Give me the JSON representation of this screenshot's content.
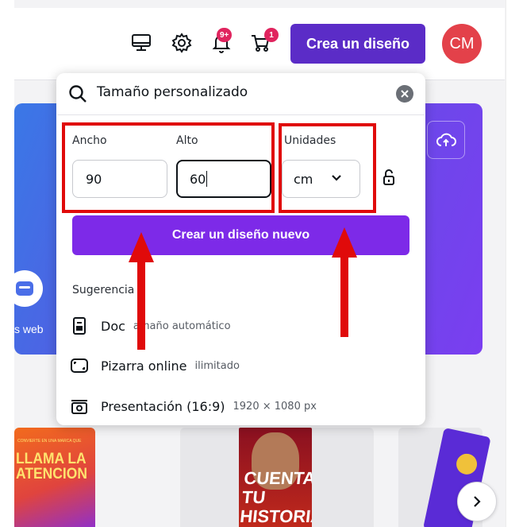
{
  "topbar": {
    "notifications_badge": "9+",
    "cart_badge": "1",
    "create_button_label": "Crea un diseño",
    "avatar_initials": "CM",
    "icons": [
      "desktop-icon",
      "gear-icon",
      "bell-icon",
      "cart-icon"
    ]
  },
  "hero": {
    "partial_text": "s web",
    "accent_color": "#7a3ef0"
  },
  "panel": {
    "search": {
      "value": "Tamaño personalizado"
    },
    "width_label": "Ancho",
    "height_label": "Alto",
    "units_label": "Unidades",
    "width_value": "90",
    "height_value": "60",
    "units_value": "cm",
    "create_button_label": "Crear un diseño nuevo",
    "suggestions_title": "Sugerencia",
    "suggestions": [
      {
        "name": "Doc",
        "desc": "amaño automático",
        "icon": "doc-icon"
      },
      {
        "name": "Pizarra online",
        "desc": "ilimitado",
        "icon": "whiteboard-icon"
      },
      {
        "name": "Presentación (16:9)",
        "desc": "1920 × 1080 px",
        "icon": "presentation-icon"
      }
    ]
  },
  "cards": {
    "card1_small": "CONVIERTE EN UNA MARCA QUE",
    "card1_title_line1": "LLAMA LA",
    "card1_title_line2": "ATENCION",
    "card2_title_line1": "CUENTA",
    "card2_title_line2": "TU",
    "card2_title_line3": "HISTORIA"
  },
  "colors": {
    "brand_purple": "#7d2ae8",
    "create_button": "#5b2cc7",
    "annotation_red": "#e00a0a",
    "avatar": "#e3414a"
  }
}
